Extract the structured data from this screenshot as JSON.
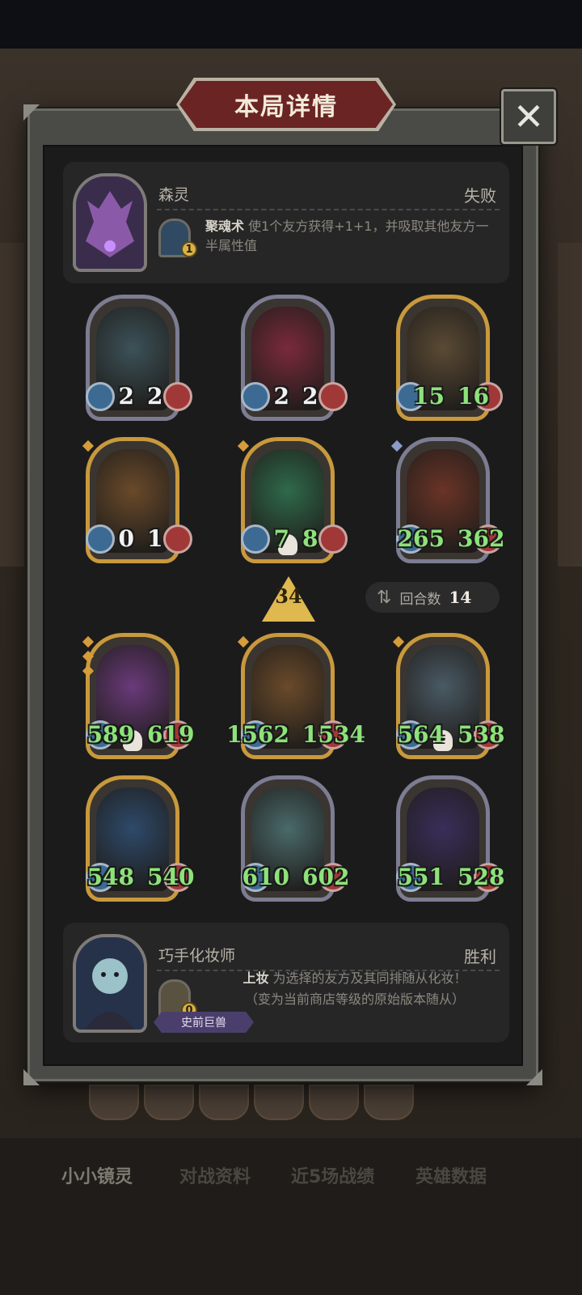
{
  "header": {
    "title": "本局详情",
    "close_icon": "close-icon"
  },
  "opponent": {
    "name": "森灵",
    "result": "失败",
    "skill": {
      "name": "聚魂术",
      "desc": "使1个友方获得+1+1，并吸取其他友方一半属性值",
      "cost": "1"
    }
  },
  "opponent_board": [
    {
      "atk": "2",
      "hp": "2",
      "color": "white",
      "frame": "blue",
      "art": "#3c5258"
    },
    {
      "atk": "2",
      "hp": "2",
      "color": "white",
      "frame": "blue",
      "art": "#7a2a3a"
    },
    {
      "atk": "15",
      "hp": "16",
      "color": "green",
      "frame": "gold",
      "art": "#5a4a34"
    },
    {
      "atk": "0",
      "hp": "1",
      "color": "white",
      "frame": "gold",
      "art": "#6a4a2a"
    },
    {
      "atk": "7",
      "hp": "8",
      "color": "green",
      "frame": "gold",
      "art": "#2f6a4a"
    },
    {
      "atk": "265",
      "hp": "362",
      "color": "green",
      "frame": "blue",
      "art": "#6a3426"
    }
  ],
  "turn_info": {
    "tier": "34",
    "round_label": "回合数",
    "round_value": "14"
  },
  "player_board": [
    {
      "atk": "589",
      "hp": "619",
      "color": "green",
      "frame": "gold",
      "art": "#6a3a7a"
    },
    {
      "atk": "1562",
      "hp": "1534",
      "color": "green",
      "frame": "gold",
      "art": "#6a4a2a"
    },
    {
      "atk": "564",
      "hp": "538",
      "color": "green",
      "frame": "gold",
      "art": "#4a5a64"
    },
    {
      "atk": "548",
      "hp": "540",
      "color": "green",
      "frame": "gold",
      "art": "#2e4a6a"
    },
    {
      "atk": "610",
      "hp": "602",
      "color": "green",
      "frame": "blue",
      "art": "#4a6a6a"
    },
    {
      "atk": "551",
      "hp": "528",
      "color": "green",
      "frame": "blue",
      "art": "#3a2e5a"
    }
  ],
  "player": {
    "name": "巧手化妆师",
    "result": "胜利",
    "skill": {
      "name": "上妆",
      "desc_a": "为选择的友方及其同排随从化妆！",
      "desc_b": "（变为当前商店等级的原始版本随从）",
      "cost": "0"
    },
    "tribe": "史前巨兽"
  },
  "tabs": [
    "小小镜灵",
    "对战资料",
    "近5场战绩",
    "英雄数据"
  ],
  "colors": {
    "accent_red": "#6a2424",
    "stat_green": "#8ee27a",
    "gold_frame": "#c8993d"
  }
}
